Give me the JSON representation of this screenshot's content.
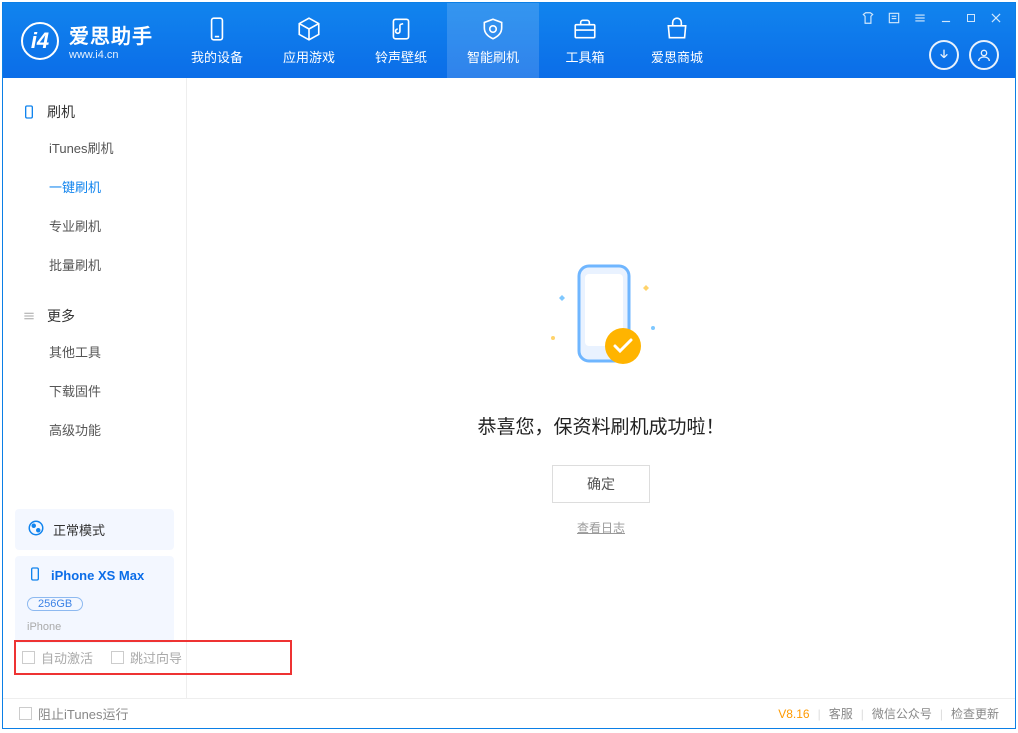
{
  "brand": {
    "name": "爱思助手",
    "site": "www.i4.cn"
  },
  "tabs": [
    {
      "label": "我的设备"
    },
    {
      "label": "应用游戏"
    },
    {
      "label": "铃声壁纸"
    },
    {
      "label": "智能刷机"
    },
    {
      "label": "工具箱"
    },
    {
      "label": "爱思商城"
    }
  ],
  "sidebar": {
    "group1": {
      "title": "刷机",
      "items": [
        "iTunes刷机",
        "一键刷机",
        "专业刷机",
        "批量刷机"
      ]
    },
    "group2": {
      "title": "更多",
      "items": [
        "其他工具",
        "下载固件",
        "高级功能"
      ]
    }
  },
  "device": {
    "mode": "正常模式",
    "name": "iPhone XS Max",
    "storage": "256GB",
    "type": "iPhone"
  },
  "main": {
    "message": "恭喜您，保资料刷机成功啦！",
    "ok": "确定",
    "log": "查看日志"
  },
  "checkboxes": {
    "auto_activate": "自动激活",
    "skip_guide": "跳过向导"
  },
  "footer": {
    "block_itunes": "阻止iTunes运行",
    "version": "V8.16",
    "support": "客服",
    "wechat": "微信公众号",
    "update": "检查更新"
  }
}
